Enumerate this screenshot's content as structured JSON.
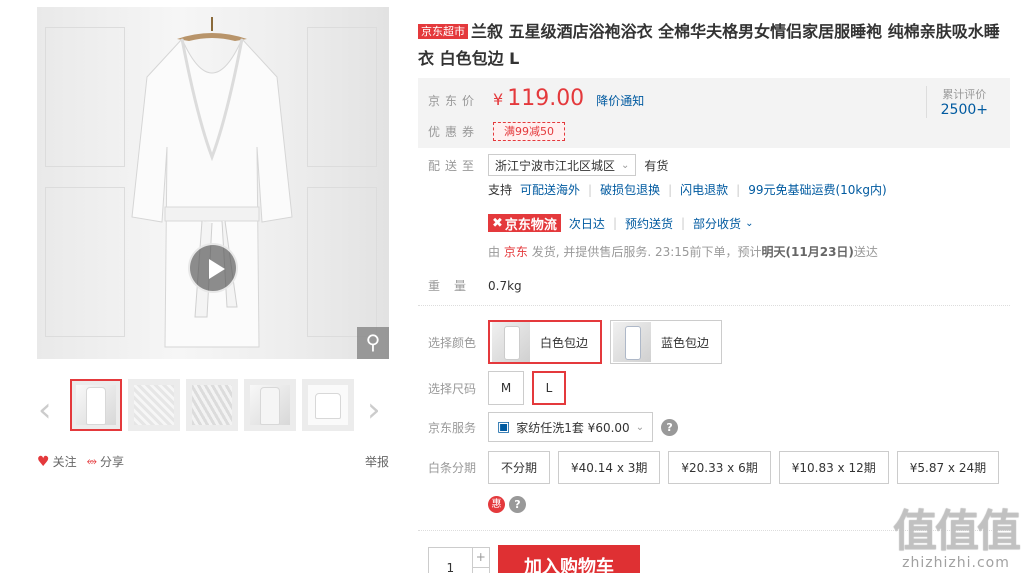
{
  "gallery": {
    "thumb_count": 5,
    "prev_icon": "chevron-left-icon",
    "next_icon": "chevron-right-icon",
    "follow_label": "关注",
    "share_label": "分享",
    "report_label": "举报"
  },
  "product": {
    "tag": "京东超市",
    "title": "兰叙 五星级酒店浴袍浴衣 全棉华夫格男女情侣家居服睡袍 纯棉亲肤吸水睡衣 白色包边 L"
  },
  "summary": {
    "price_label": "京东价",
    "currency": "¥",
    "price": "119.00",
    "notify_label": "降价通知",
    "coupon_label": "优惠券",
    "coupon": "满99减50",
    "review_label": "累计评价",
    "review_count": "2500+"
  },
  "delivery": {
    "label": "配送至",
    "location": "浙江宁波市江北区城区",
    "stock": "有货",
    "support_label": "支持",
    "support_links": [
      "可配送海外",
      "破损包退换",
      "闪电退款",
      "99元免基础运费(10kg内)"
    ],
    "logistics_brand": "京东物流",
    "logistics_links": [
      "次日达",
      "预约送货",
      "部分收货"
    ],
    "note_prefix": "由",
    "note_seller": "京东",
    "note_mid": "发货, 并提供售后服务. 23:15前下单，预计",
    "note_date": "明天(11月23日)",
    "note_suffix": "送达"
  },
  "weight": {
    "label": "重量",
    "value": "0.7kg"
  },
  "options": {
    "color_label": "选择颜色",
    "colors": [
      "白色包边",
      "蓝色包边"
    ],
    "selected_color": "白色包边",
    "size_label": "选择尺码",
    "sizes": [
      "M",
      "L"
    ],
    "selected_size": "L",
    "service_label": "京东服务",
    "service_value": "家纺任洗1套 ¥60.00",
    "installment_label": "白条分期",
    "installments": [
      "不分期",
      "¥40.14 x 3期",
      "¥20.33 x 6期",
      "¥10.83 x 12期",
      "¥5.87 x 24期"
    ]
  },
  "purchase": {
    "quantity": "1",
    "plus": "+",
    "cart_label": "加入购物车"
  },
  "watermark": {
    "logo": "值值值",
    "url": "zhizhizhi.com"
  },
  "colors": {
    "accent": "#e4393c",
    "link": "#005aa0"
  }
}
